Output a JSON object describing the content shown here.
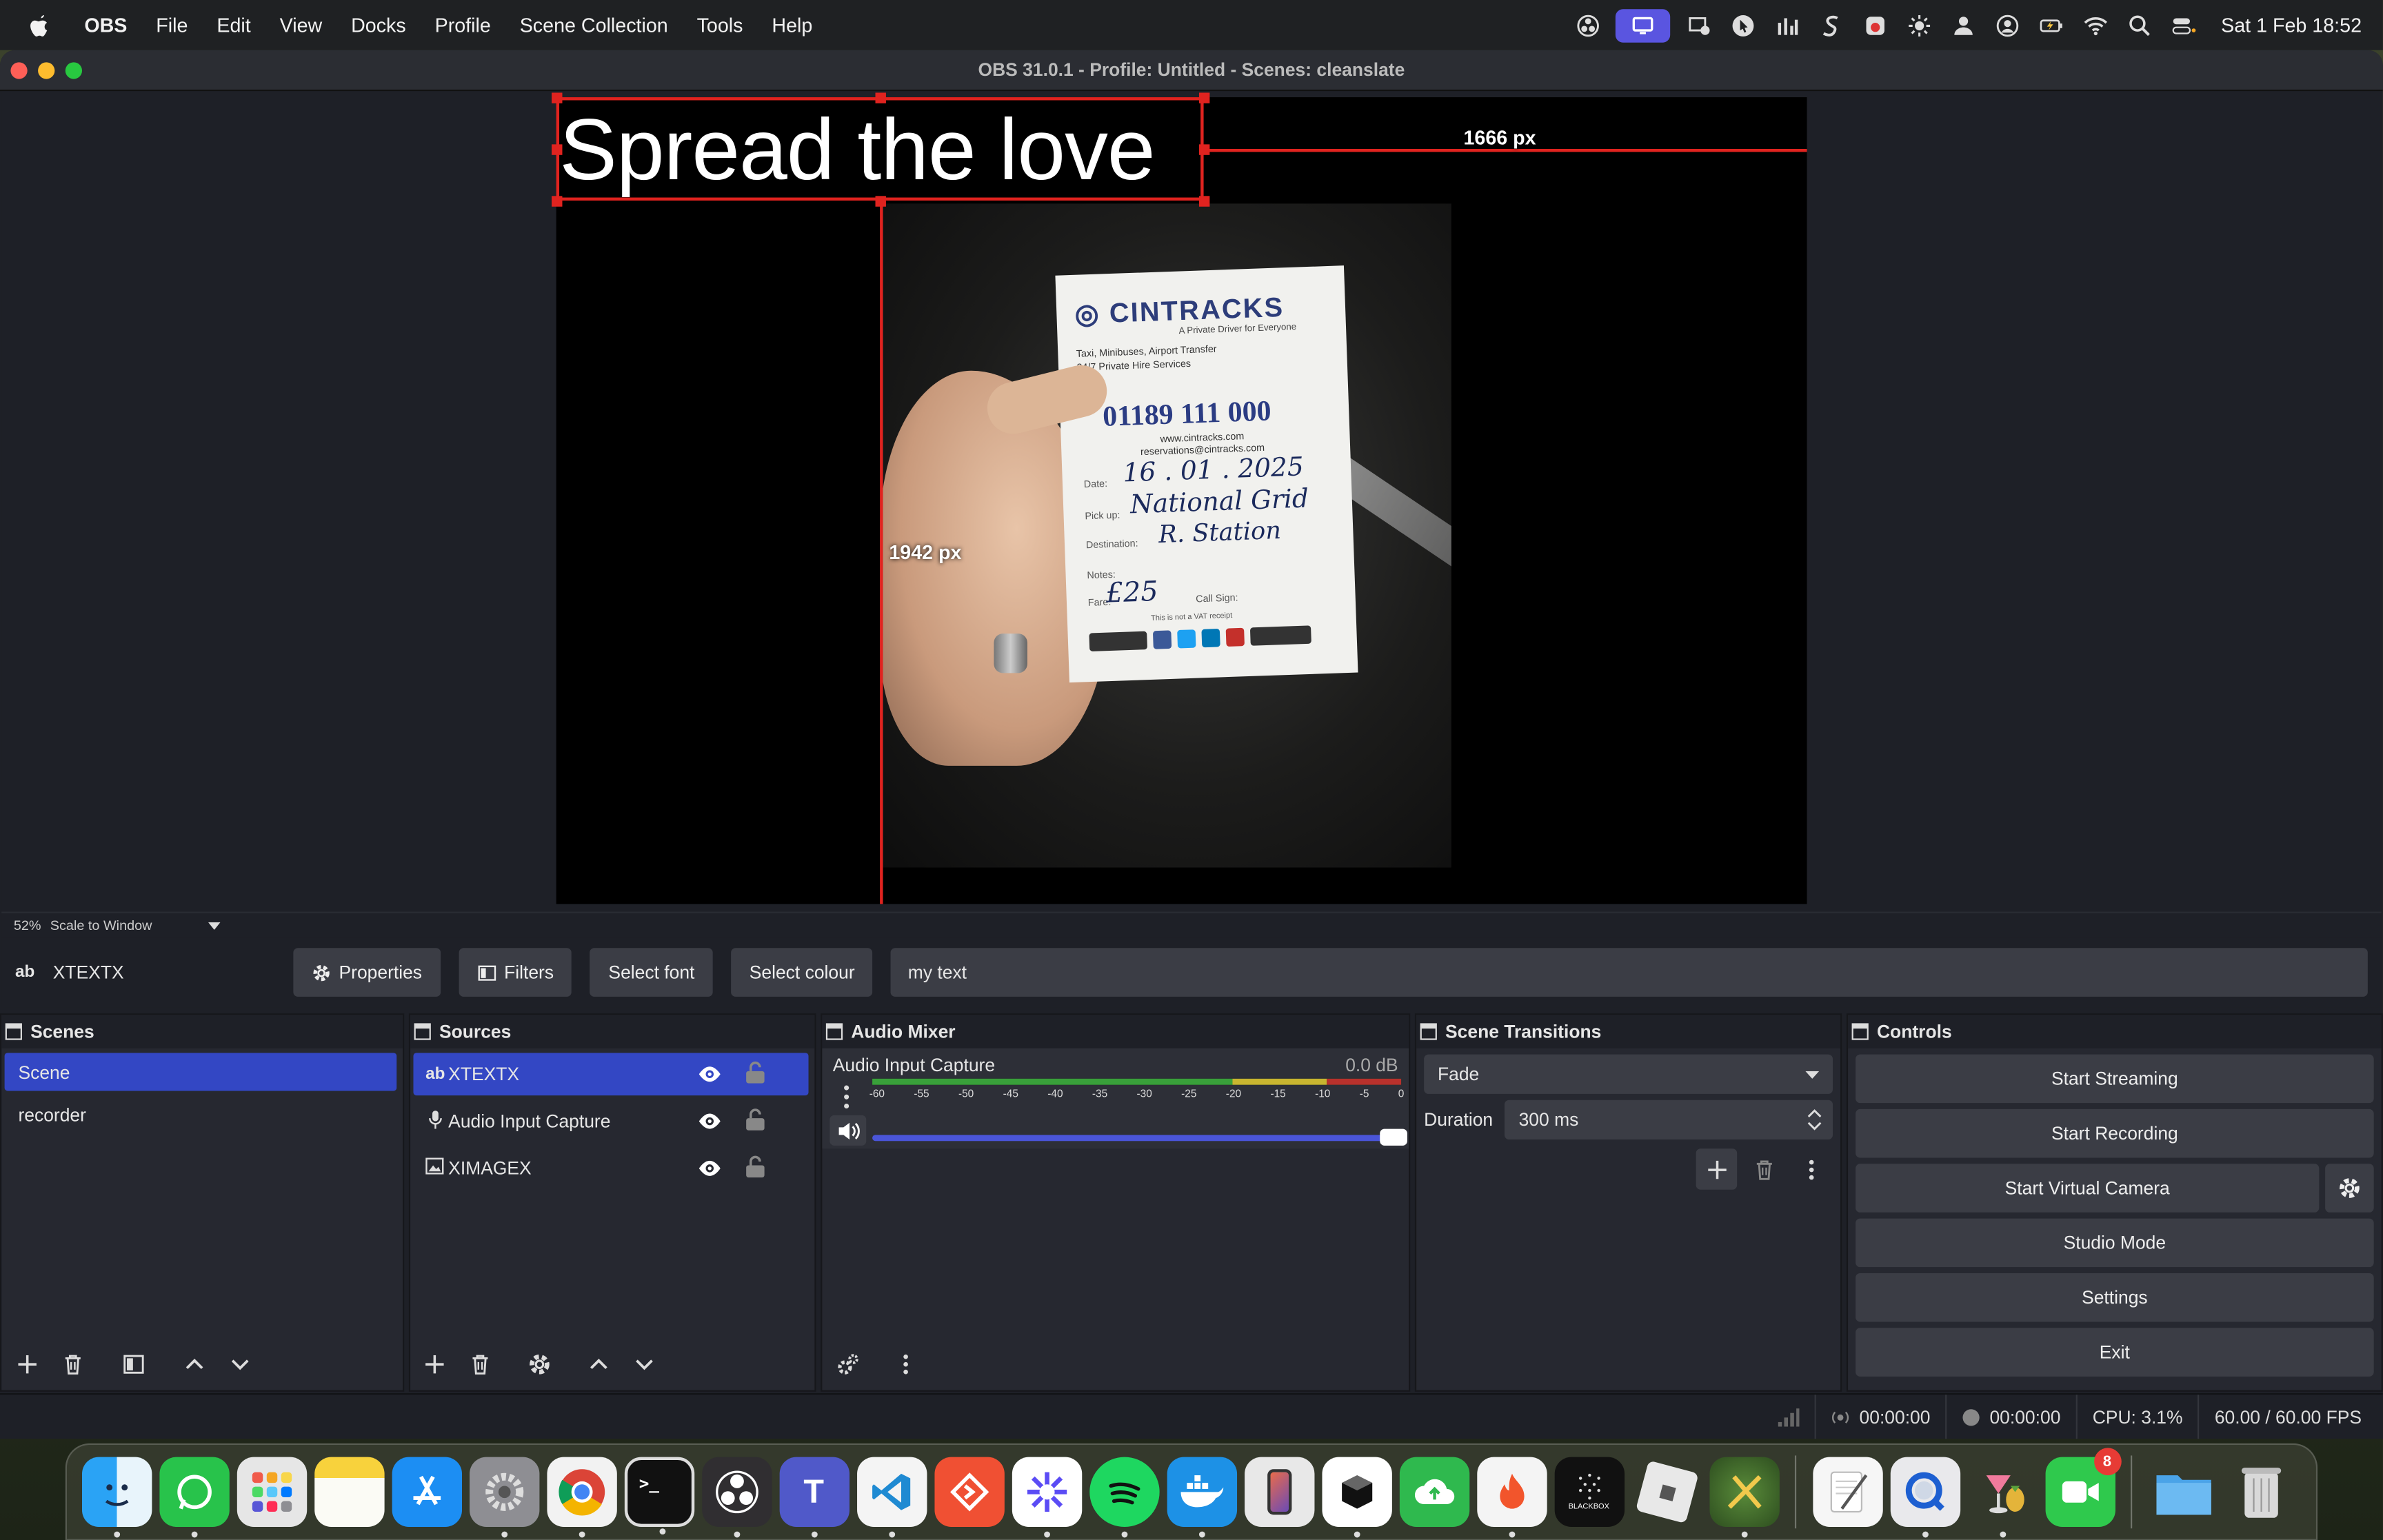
{
  "menubar": {
    "app_name": "OBS",
    "items": [
      "File",
      "Edit",
      "View",
      "Docks",
      "Profile",
      "Scene Collection",
      "Tools",
      "Help"
    ],
    "clock": "Sat 1 Feb  18:52"
  },
  "window": {
    "title": "OBS 31.0.1 - Profile: Untitled - Scenes: cleanslate"
  },
  "preview": {
    "overlay_text": "Spread the love",
    "width_label": "1666 px",
    "height_label": "1942 px",
    "receipt": {
      "brand": "CINTRACKS",
      "tagline": "A Private Driver for Everyone",
      "services_line1": "Taxi, Minibuses, Airport Transfer",
      "services_line2": "24/7 Private Hire Services",
      "phone": "01189 111 000",
      "web": "www.cintracks.com",
      "email": "reservations@cintracks.com",
      "date_label": "Date:",
      "date_value": "16 . 01 . 2025",
      "pickup_label": "Pick up:",
      "pickup_value": "National Grid",
      "destination_label": "Destination:",
      "destination_value": "R. Station",
      "notes_label": "Notes:",
      "fare_label": "Fare:",
      "fare_value": "£25",
      "callsign_label": "Call Sign:",
      "vat_note": "This is not a VAT receipt"
    }
  },
  "zoombar": {
    "zoom": "52%",
    "scale_mode": "Scale to Window"
  },
  "context": {
    "source_icon": "ab",
    "source_name": "XTEXTX",
    "properties": "Properties",
    "filters": "Filters",
    "select_font": "Select font",
    "select_colour": "Select colour",
    "text_value": "my text"
  },
  "scenes": {
    "title": "Scenes",
    "items": [
      "Scene",
      "recorder"
    ]
  },
  "sources": {
    "title": "Sources",
    "items": [
      {
        "icon": "ab",
        "name": "XTEXTX"
      },
      {
        "icon": "mic",
        "name": "Audio Input Capture"
      },
      {
        "icon": "image",
        "name": "XIMAGEX"
      }
    ]
  },
  "mixer": {
    "title": "Audio Mixer",
    "channel": "Audio Input Capture",
    "level": "0.0 dB",
    "ticks": [
      "-60",
      "-55",
      "-50",
      "-45",
      "-40",
      "-35",
      "-30",
      "-25",
      "-20",
      "-15",
      "-10",
      "-5",
      "0"
    ],
    "volume_fraction": 1.0
  },
  "transitions": {
    "title": "Scene Transitions",
    "selected": "Fade",
    "duration_label": "Duration",
    "duration_value": "300 ms"
  },
  "controls": {
    "title": "Controls",
    "start_streaming": "Start Streaming",
    "start_recording": "Start Recording",
    "start_virtual_camera": "Start Virtual Camera",
    "studio_mode": "Studio Mode",
    "settings": "Settings",
    "exit": "Exit"
  },
  "status": {
    "stream_time": "00:00:00",
    "record_time": "00:00:00",
    "cpu": "CPU: 3.1%",
    "fps": "60.00 / 60.00 FPS"
  },
  "dock": {
    "blackbox_label": "BLACKBOX",
    "facetime_badge": "8"
  },
  "colors": {
    "accent": "#3347c4",
    "selection": "#e0231f",
    "panel": "#262830"
  }
}
